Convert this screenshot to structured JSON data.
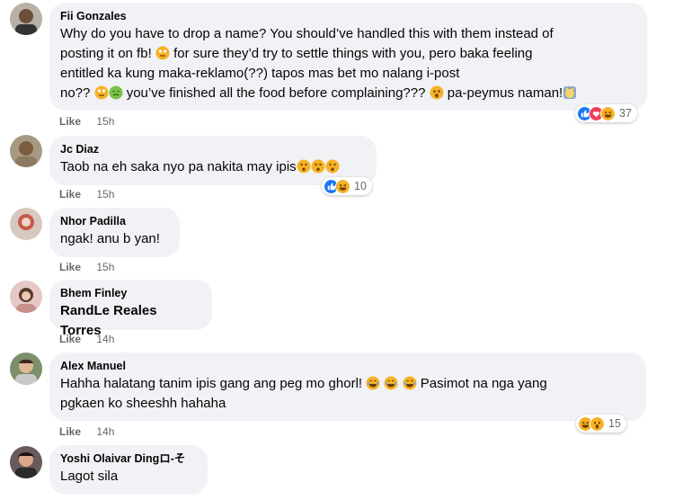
{
  "comments": [
    {
      "name": "Fii Gonzales",
      "lines": [
        "Why do you have to drop a name? You should’ve handled this with them instead of",
        "posting it on fb!",
        "for sure they’d try to settle things with you, pero baka feeling",
        "entitled ka kung maka-reklamo(??) tapos mas bet mo nalang i-post",
        "no??",
        "you’ve finished all the food before complaining???",
        "pa-peymus naman!"
      ],
      "like": "Like",
      "time": "15h",
      "reaction_count": "37",
      "reactions": [
        "like-icon",
        "love-icon",
        "haha-icon"
      ]
    },
    {
      "name": "Jc Diaz",
      "text": "Taob na eh saka nyo pa nakita may ipis",
      "like": "Like",
      "time": "15h",
      "reaction_count": "10",
      "reactions": [
        "like-icon",
        "haha-icon"
      ]
    },
    {
      "name": "Nhor Padilla",
      "text": "ngak! anu b yan!",
      "like": "Like",
      "time": "15h"
    },
    {
      "name": "Bhem Finley",
      "text": "RandLe Reales Torres",
      "like": "Like",
      "time": "14h"
    },
    {
      "name": "Alex Manuel",
      "line1a": "Hahha halatang tanim ipis gang ang peg mo ghorl!",
      "line1b": "Pasimot na nga yang",
      "line2": "pgkaen ko sheeshh hahaha",
      "like": "Like",
      "time": "14h",
      "reaction_count": "15",
      "reactions": [
        "haha-icon",
        "wow-icon"
      ]
    },
    {
      "name": "Yoshi Olaivar Dingロ-そ",
      "text": "Lagot sila"
    }
  ],
  "colors": {
    "bubble": "#f0f2f5",
    "meta": "#65676b",
    "like_blue": "#1877f2",
    "love_red": "#f33e58",
    "haha_yellow": "#f7b125"
  }
}
